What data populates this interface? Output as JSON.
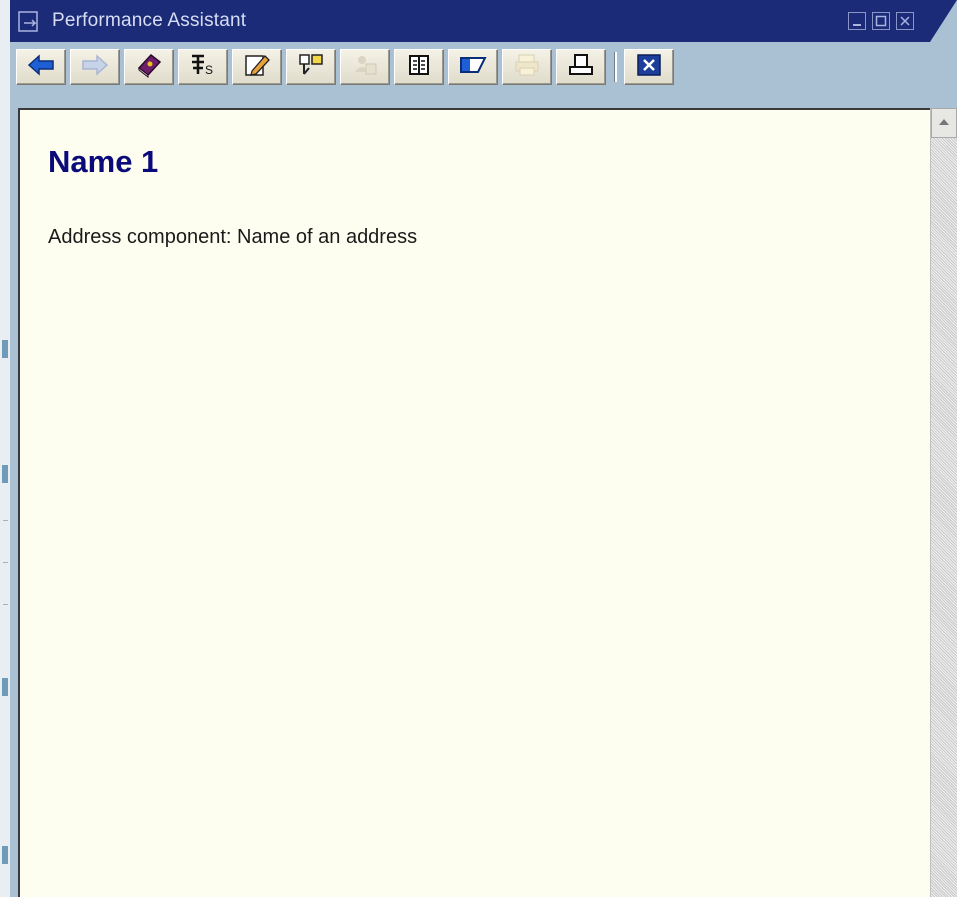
{
  "window": {
    "title": "Performance Assistant"
  },
  "toolbar": {
    "buttons": [
      {
        "name": "back",
        "icon": "arrow-left-icon",
        "enabled": true
      },
      {
        "name": "forward",
        "icon": "arrow-right-icon",
        "enabled": false
      },
      {
        "name": "glossary",
        "icon": "book-icon",
        "enabled": true
      },
      {
        "name": "technical-info",
        "icon": "technical-info-icon",
        "enabled": true
      },
      {
        "name": "edit-note",
        "icon": "pencil-note-icon",
        "enabled": true
      },
      {
        "name": "link",
        "icon": "link-icon",
        "enabled": true
      },
      {
        "name": "personal-note",
        "icon": "person-note-icon",
        "enabled": false
      },
      {
        "name": "table-of-contents",
        "icon": "book-open-icon",
        "enabled": true
      },
      {
        "name": "toggle-panel",
        "icon": "panel-toggle-icon",
        "enabled": true
      },
      {
        "name": "print-preview",
        "icon": "print-preview-icon",
        "enabled": false
      },
      {
        "name": "print",
        "icon": "printer-icon",
        "enabled": true
      },
      {
        "name": "close",
        "icon": "close-x-icon",
        "enabled": true
      }
    ]
  },
  "content": {
    "heading": "Name 1",
    "description": "Address component: Name of an address"
  },
  "colors": {
    "titlebar": "#1b2b78",
    "toolbar": "#a9c1d3",
    "content_bg": "#fdfdf0",
    "heading": "#0a0a7a"
  }
}
